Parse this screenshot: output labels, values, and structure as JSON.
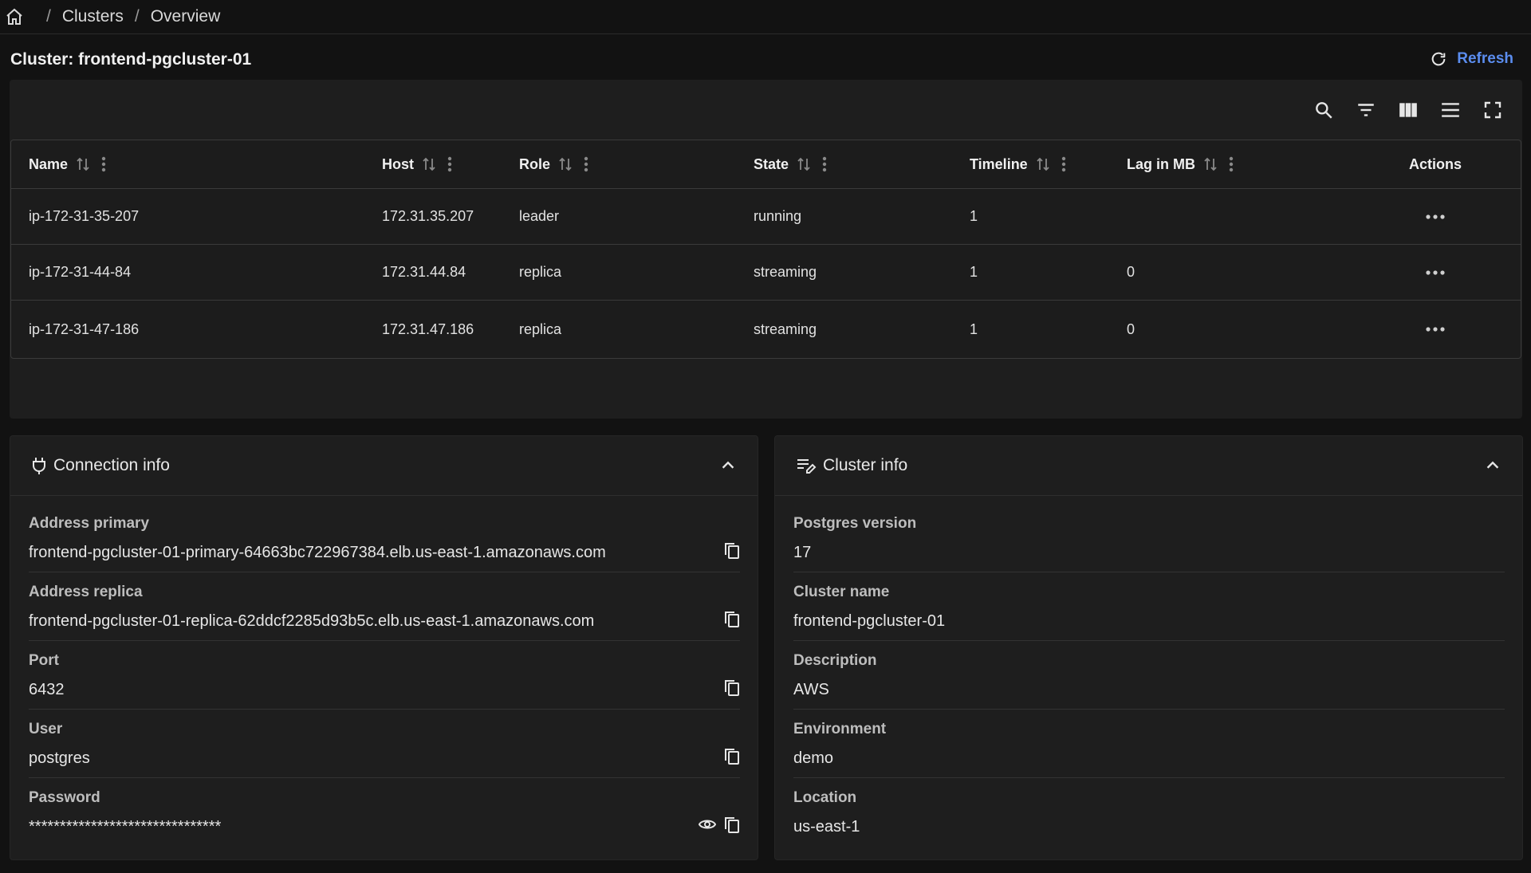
{
  "breadcrumb": {
    "items": [
      "Clusters",
      "Overview"
    ]
  },
  "header": {
    "title": "Cluster: frontend-pgcluster-01",
    "refresh_label": "Refresh"
  },
  "table": {
    "columns": {
      "name": "Name",
      "host": "Host",
      "role": "Role",
      "state": "State",
      "timeline": "Timeline",
      "lag": "Lag in MB",
      "actions": "Actions"
    },
    "rows": [
      {
        "name": "ip-172-31-35-207",
        "host": "172.31.35.207",
        "role": "leader",
        "state": "running",
        "timeline": "1",
        "lag": ""
      },
      {
        "name": "ip-172-31-44-84",
        "host": "172.31.44.84",
        "role": "replica",
        "state": "streaming",
        "timeline": "1",
        "lag": "0"
      },
      {
        "name": "ip-172-31-47-186",
        "host": "172.31.47.186",
        "role": "replica",
        "state": "streaming",
        "timeline": "1",
        "lag": "0"
      }
    ]
  },
  "connection": {
    "title": "Connection info",
    "fields": [
      {
        "label": "Address primary",
        "value": "frontend-pgcluster-01-primary-64663bc722967384.elb.us-east-1.amazonaws.com"
      },
      {
        "label": "Address replica",
        "value": "frontend-pgcluster-01-replica-62ddcf2285d93b5c.elb.us-east-1.amazonaws.com"
      },
      {
        "label": "Port",
        "value": "6432"
      },
      {
        "label": "User",
        "value": "postgres"
      },
      {
        "label": "Password",
        "value": "*******************************"
      }
    ]
  },
  "cluster": {
    "title": "Cluster info",
    "fields": [
      {
        "label": "Postgres version",
        "value": "17"
      },
      {
        "label": "Cluster name",
        "value": "frontend-pgcluster-01"
      },
      {
        "label": "Description",
        "value": "AWS"
      },
      {
        "label": "Environment",
        "value": "demo"
      },
      {
        "label": "Location",
        "value": "us-east-1"
      }
    ]
  },
  "colors": {
    "accent": "#5b8def",
    "background": "#121212",
    "panel": "#1e1e1e"
  }
}
